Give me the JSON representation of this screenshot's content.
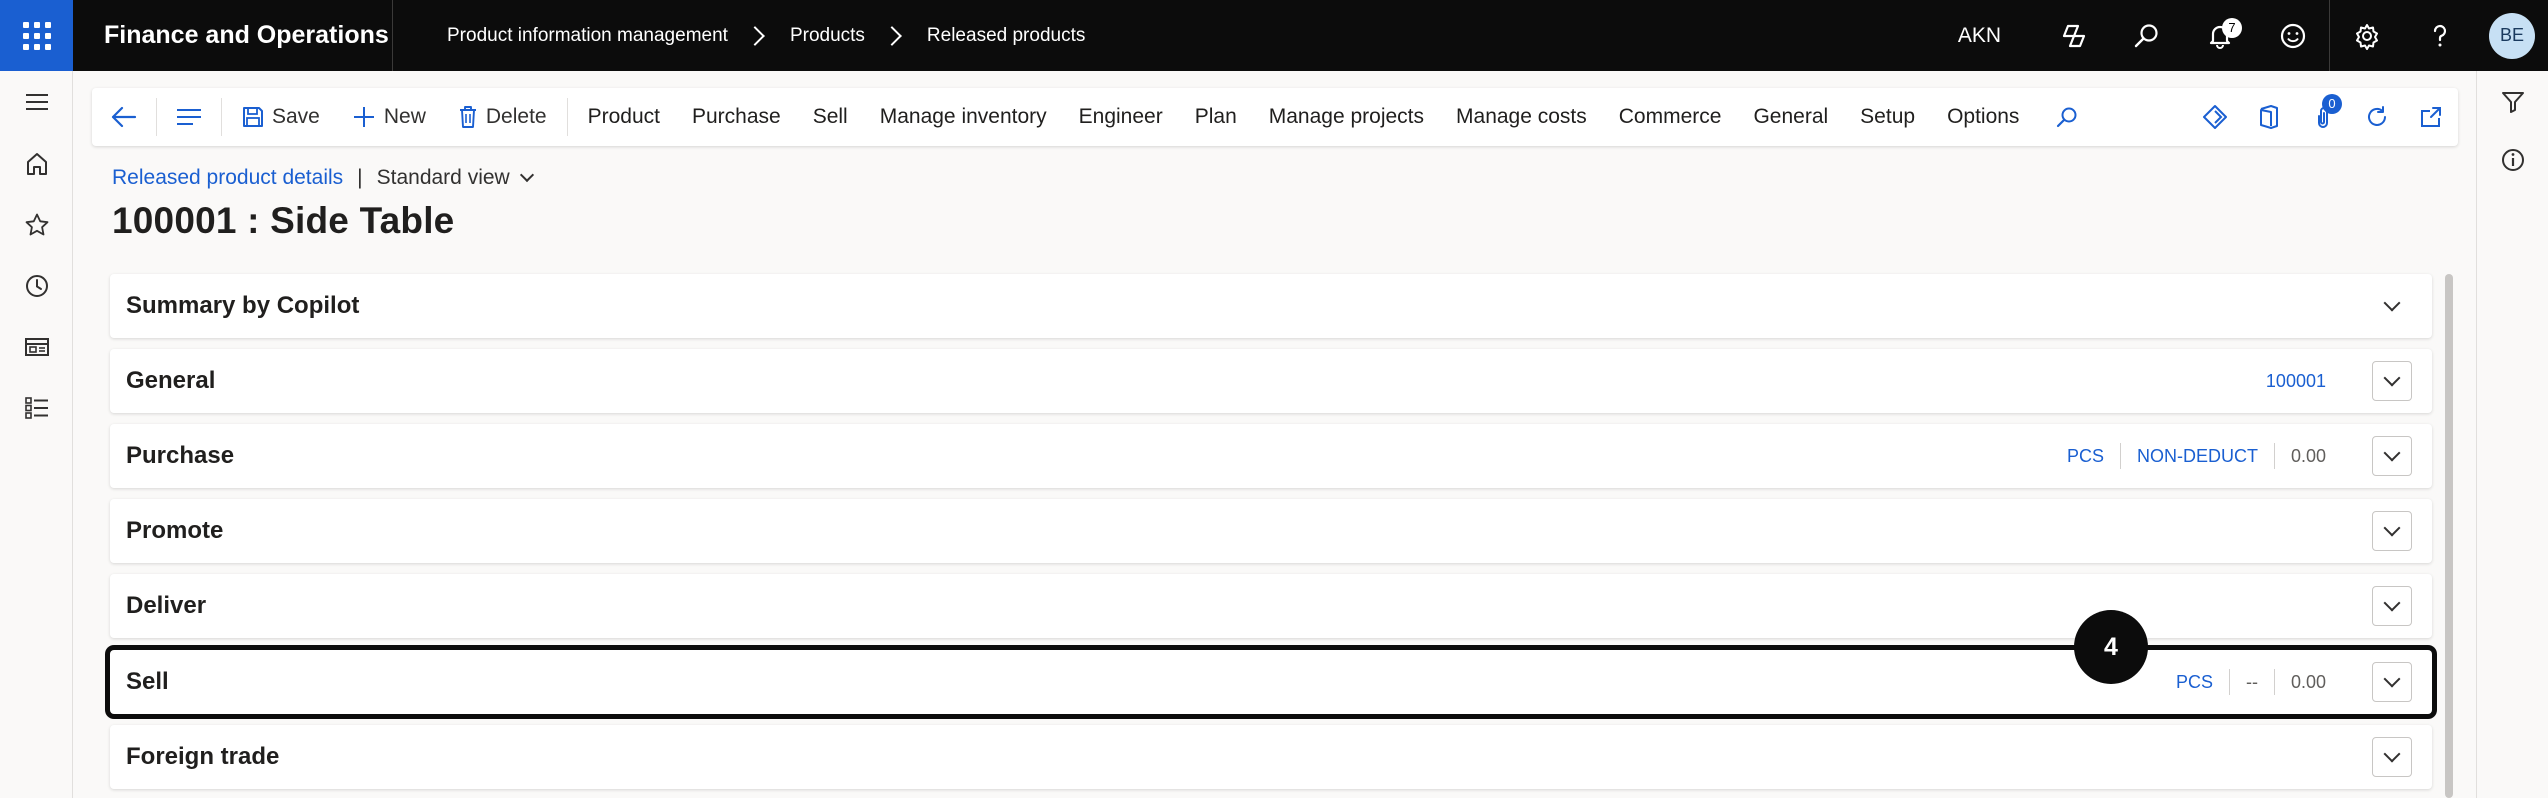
{
  "header": {
    "app_title": "Finance and Operations",
    "breadcrumb": [
      "Product information management",
      "Products",
      "Released products"
    ],
    "company": "AKN",
    "notification_count": "7",
    "avatar_initials": "BE"
  },
  "actionbar": {
    "save": "Save",
    "new": "New",
    "delete": "Delete",
    "menus": [
      "Product",
      "Purchase",
      "Sell",
      "Manage inventory",
      "Engineer",
      "Plan",
      "Manage projects",
      "Manage costs",
      "Commerce",
      "General",
      "Setup",
      "Options"
    ],
    "attachments_count": "0"
  },
  "page": {
    "form_link": "Released product details",
    "separator": "|",
    "view": "Standard view",
    "title": "100001 : Side Table"
  },
  "fasttabs": [
    {
      "title": "Summary by Copilot",
      "summary": []
    },
    {
      "title": "General",
      "summary": [
        {
          "text": "100001",
          "link": true
        }
      ]
    },
    {
      "title": "Purchase",
      "summary": [
        {
          "text": "PCS",
          "link": true
        },
        {
          "text": "NON-DEDUCT",
          "link": true
        },
        {
          "text": "0.00",
          "link": false
        }
      ]
    },
    {
      "title": "Promote",
      "summary": []
    },
    {
      "title": "Deliver",
      "summary": []
    },
    {
      "title": "Sell",
      "summary": [
        {
          "text": "PCS",
          "link": true
        },
        {
          "text": "--",
          "link": false
        },
        {
          "text": "0.00",
          "link": false
        }
      ]
    },
    {
      "title": "Foreign trade",
      "summary": []
    }
  ],
  "step_badge": "4",
  "colors": {
    "accent": "#1a5fd1",
    "header_bg": "#0c0c0c"
  }
}
